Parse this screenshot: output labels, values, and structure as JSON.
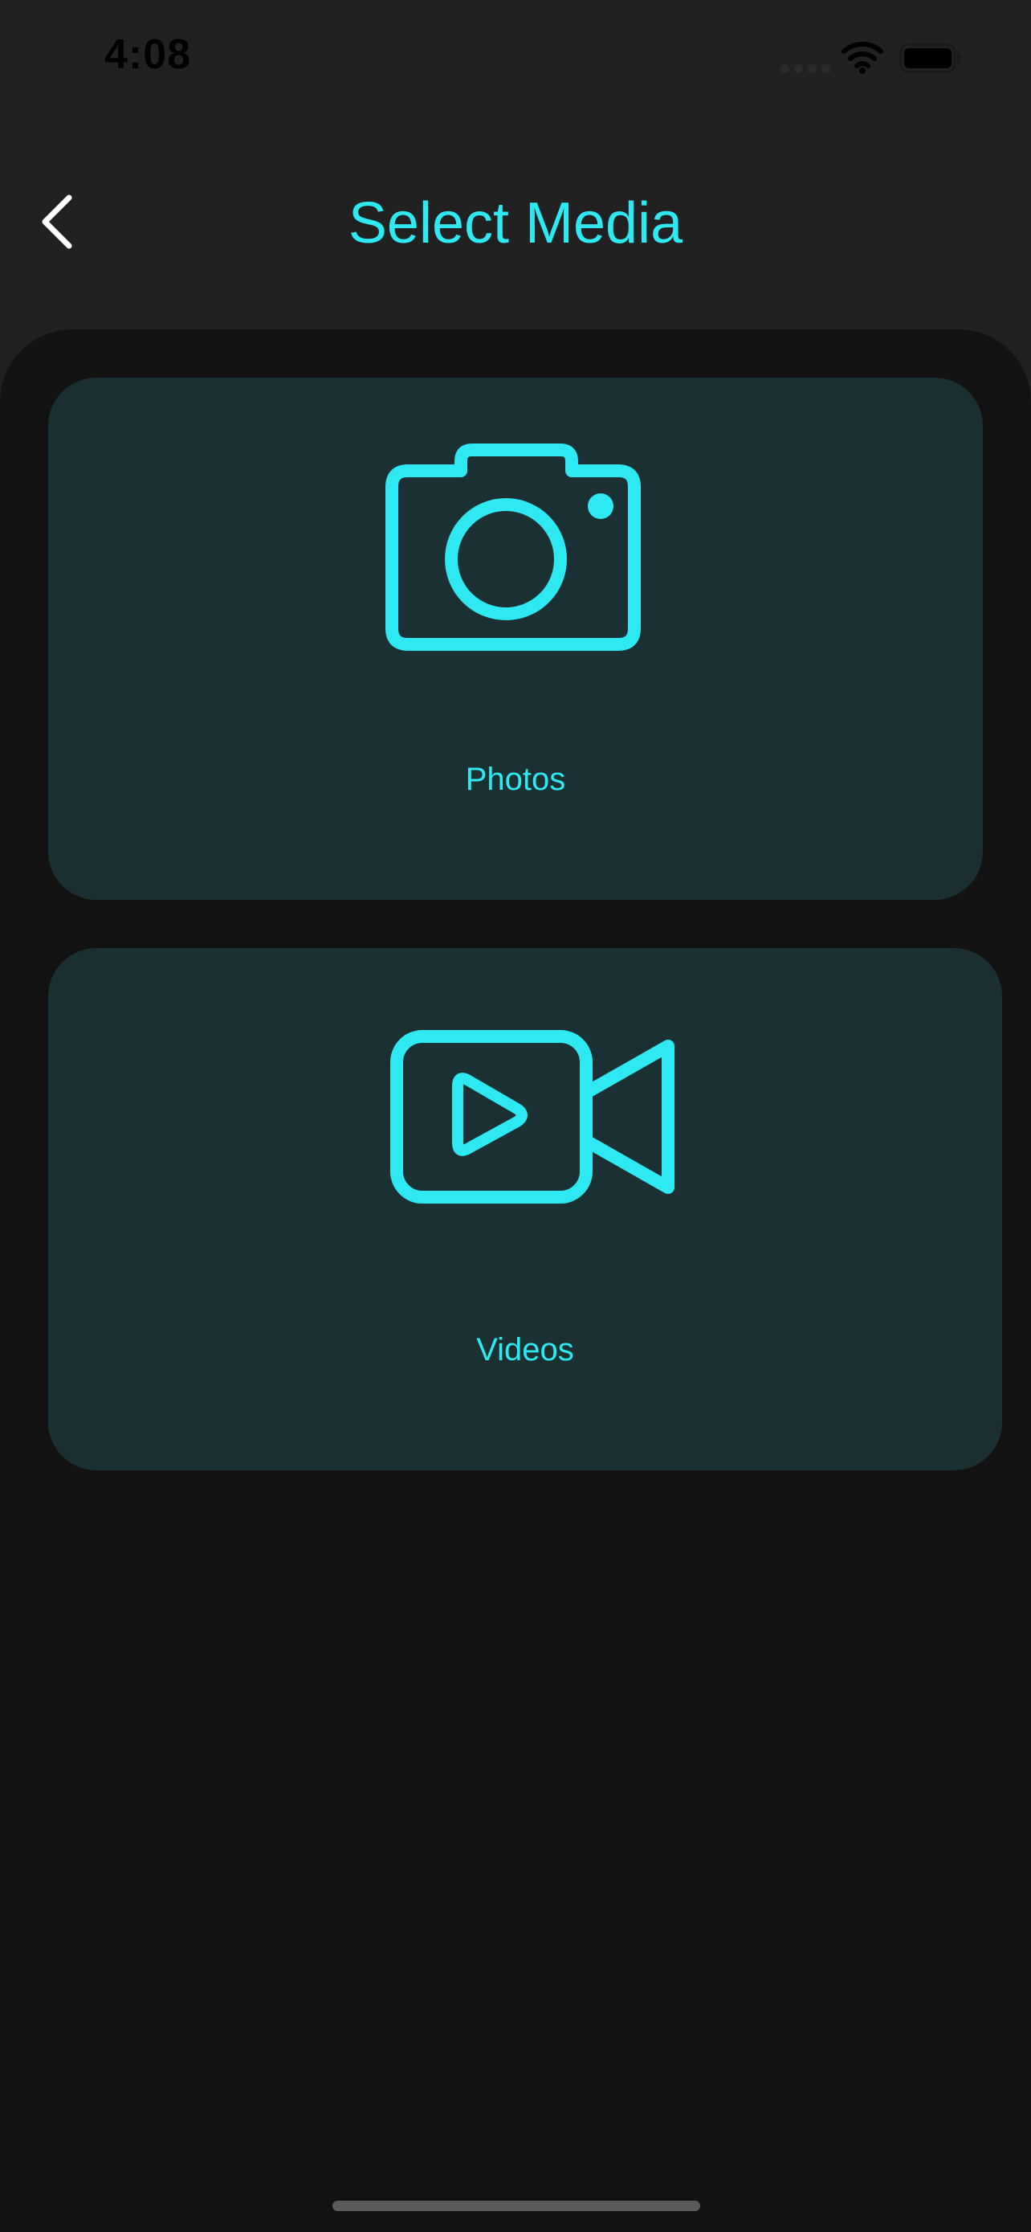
{
  "status_bar": {
    "time": "4:08",
    "signal_icon": "cellular-signal-icon",
    "wifi_icon": "wifi-icon",
    "battery_icon": "battery-icon"
  },
  "header": {
    "back_icon": "chevron-left-icon",
    "title": "Select Media"
  },
  "cards": {
    "photos": {
      "icon": "camera-icon",
      "label": "Photos"
    },
    "videos": {
      "icon": "video-camera-icon",
      "label": "Videos"
    }
  },
  "colors": {
    "accent": "#2ee8f2",
    "background": "#212121",
    "panel": "#121212",
    "card": "#1a3032"
  }
}
